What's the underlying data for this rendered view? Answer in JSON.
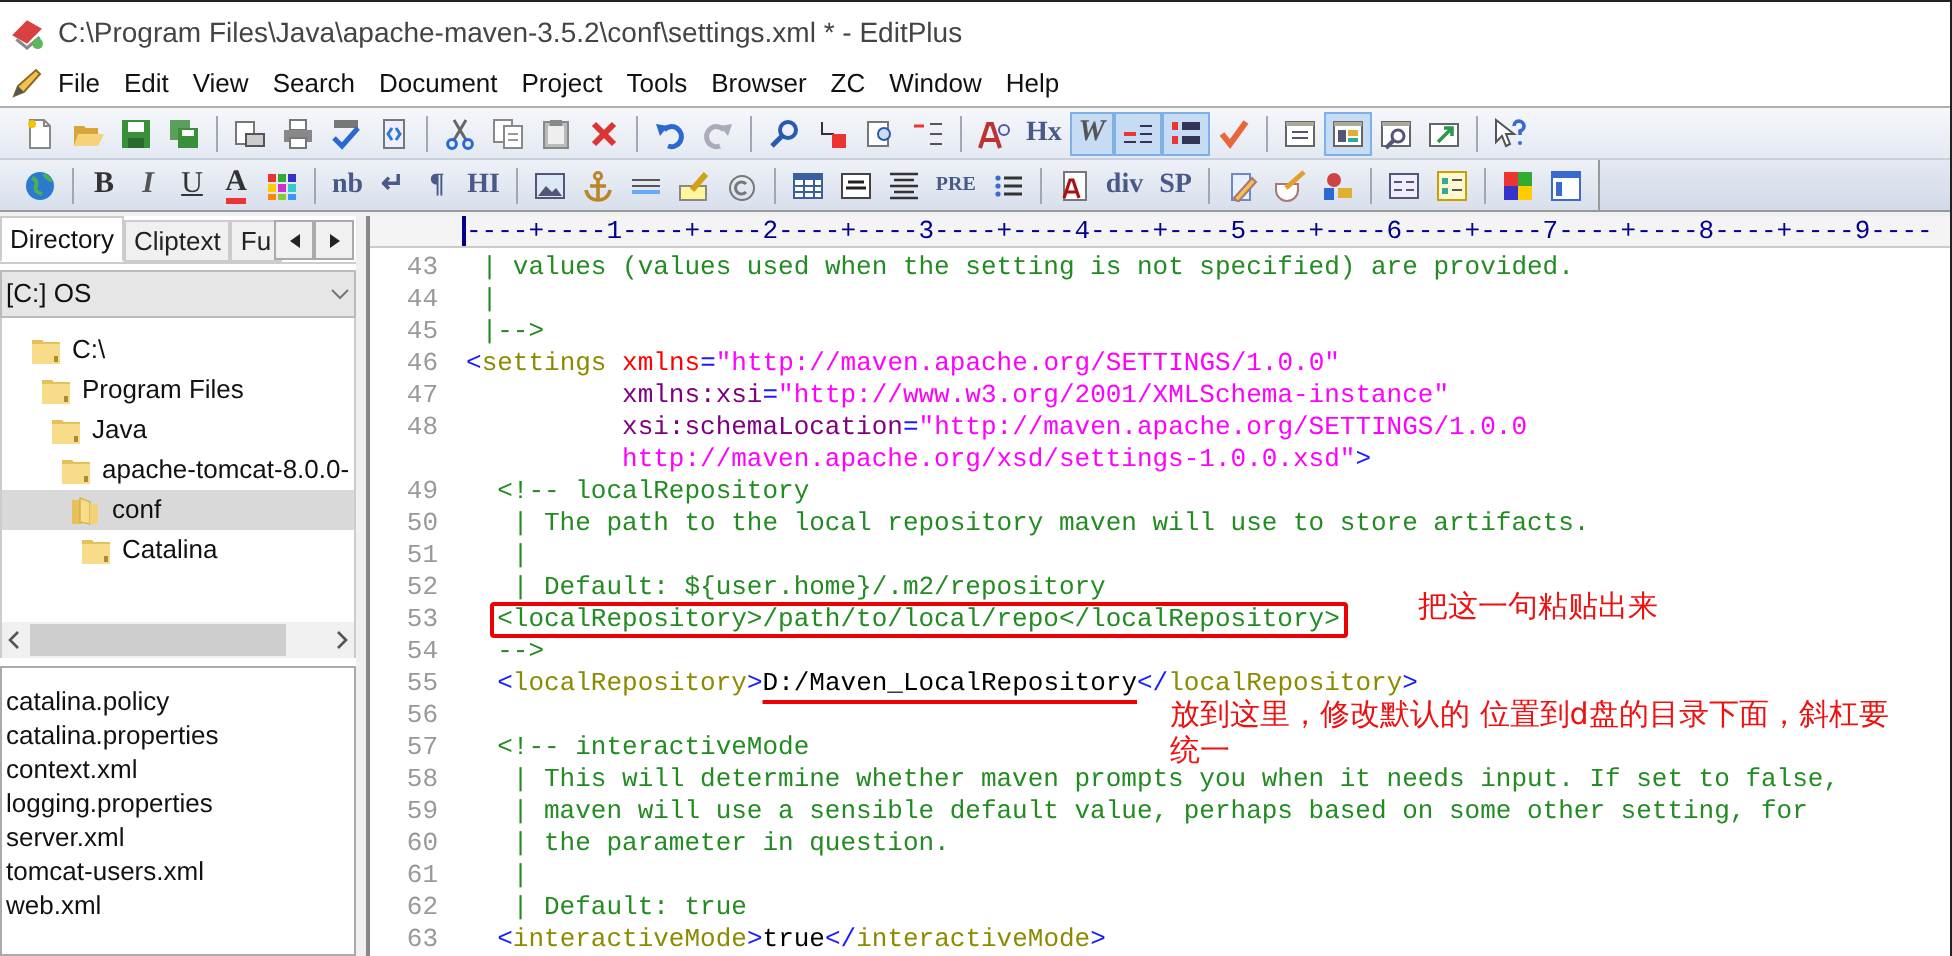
{
  "window": {
    "title": "C:\\Program Files\\Java\\apache-maven-3.5.2\\conf\\settings.xml * - EditPlus"
  },
  "menu": [
    "File",
    "Edit",
    "View",
    "Search",
    "Document",
    "Project",
    "Tools",
    "Browser",
    "ZC",
    "Window",
    "Help"
  ],
  "toolbar_1": [
    [
      {
        "kind": "icon",
        "on": false
      },
      {
        "kind": "icon",
        "on": false
      },
      {
        "kind": "icon",
        "on": false
      },
      {
        "kind": "icon",
        "on": false
      }
    ],
    [
      {
        "kind": "icon",
        "on": false
      },
      {
        "kind": "icon",
        "on": false
      },
      {
        "kind": "icon",
        "on": false
      },
      {
        "kind": "icon",
        "on": false
      }
    ],
    [
      {
        "kind": "icon",
        "on": false
      },
      {
        "kind": "icon",
        "on": false
      },
      {
        "kind": "icon",
        "on": false
      },
      {
        "kind": "icon",
        "on": false
      }
    ],
    [
      {
        "kind": "icon",
        "on": false
      },
      {
        "kind": "icon",
        "on": false
      }
    ],
    [
      {
        "kind": "icon",
        "on": false
      },
      {
        "kind": "icon",
        "on": false
      },
      {
        "kind": "icon",
        "on": false
      },
      {
        "kind": "icon",
        "on": false
      }
    ],
    [
      {
        "kind": "icon",
        "on": false
      },
      {
        "kind": "text",
        "label": "Hx",
        "on": false
      },
      {
        "kind": "italic",
        "label": "W",
        "on": true
      },
      {
        "kind": "icon",
        "on": true
      },
      {
        "kind": "icon",
        "on": true
      },
      {
        "kind": "icon",
        "on": false
      }
    ],
    [
      {
        "kind": "icon",
        "on": false
      },
      {
        "kind": "icon",
        "on": true
      },
      {
        "kind": "icon",
        "on": false
      },
      {
        "kind": "icon",
        "on": false
      }
    ],
    [
      {
        "kind": "icon",
        "on": false
      }
    ]
  ],
  "toolbar_2": [
    [
      {
        "kind": "icon"
      }
    ],
    [
      {
        "kind": "bold",
        "label": "B"
      },
      {
        "kind": "italic",
        "label": "I"
      },
      {
        "kind": "underline",
        "label": "U"
      },
      {
        "kind": "color",
        "label": "A"
      },
      {
        "kind": "icon"
      }
    ],
    [
      {
        "kind": "text",
        "label": "nb"
      },
      {
        "kind": "text",
        "label": "↵"
      },
      {
        "kind": "text",
        "label": "¶"
      },
      {
        "kind": "text",
        "label": "HI"
      }
    ],
    [
      {
        "kind": "icon"
      },
      {
        "kind": "icon"
      },
      {
        "kind": "icon"
      },
      {
        "kind": "icon"
      },
      {
        "kind": "icon"
      }
    ],
    [
      {
        "kind": "icon"
      },
      {
        "kind": "icon"
      },
      {
        "kind": "icon"
      },
      {
        "kind": "small",
        "label": "PRE"
      },
      {
        "kind": "icon"
      }
    ],
    [
      {
        "kind": "icon"
      },
      {
        "kind": "text",
        "label": "div"
      },
      {
        "kind": "text",
        "label": "SP"
      }
    ],
    [
      {
        "kind": "icon"
      },
      {
        "kind": "icon"
      },
      {
        "kind": "icon"
      }
    ],
    [
      {
        "kind": "icon"
      },
      {
        "kind": "icon"
      }
    ],
    [
      {
        "kind": "icon"
      },
      {
        "kind": "icon"
      }
    ]
  ],
  "side_tabs": [
    {
      "label": "Directory",
      "selected": true
    },
    {
      "label": "Cliptext",
      "selected": false
    },
    {
      "label": "Fu",
      "selected": false
    }
  ],
  "drive": {
    "value": "[C:] OS"
  },
  "tree": [
    {
      "label": "C:\\",
      "selected": false,
      "children": [
        {
          "label": "Program Files",
          "selected": false,
          "children": [
            {
              "label": "Java",
              "selected": false,
              "children": [
                {
                  "label": "apache-tomcat-8.0.0-",
                  "selected": false,
                  "children": [
                    {
                      "label": "conf",
                      "selected": true,
                      "children": [
                        {
                          "label": "Catalina",
                          "selected": false
                        }
                      ]
                    }
                  ]
                }
              ]
            }
          ]
        }
      ]
    }
  ],
  "files": [
    {
      "name": "catalina.policy",
      "selected": false
    },
    {
      "name": "catalina.properties",
      "selected": false
    },
    {
      "name": "context.xml",
      "selected": false
    },
    {
      "name": "logging.properties",
      "selected": false
    },
    {
      "name": "server.xml",
      "selected": false
    },
    {
      "name": "tomcat-users.xml",
      "selected": false
    },
    {
      "name": "web.xml",
      "selected": false
    }
  ],
  "ruler": "----+----1----+----2----+----3----+----4----+----5----+----6----+----7----+----8----+----9----",
  "lines": [
    {
      "number": "43",
      "segments": [
        {
          "kind": "comment",
          "text": " | values (values used when the setting is not specified) are provided."
        }
      ]
    },
    {
      "number": "44",
      "segments": [
        {
          "kind": "comment",
          "text": " |"
        }
      ]
    },
    {
      "number": "45",
      "segments": [
        {
          "kind": "comment",
          "text": " |-->"
        }
      ]
    },
    {
      "number": "46",
      "segments": [
        {
          "kind": "bracket",
          "text": "<"
        },
        {
          "kind": "tag",
          "text": "settings"
        },
        {
          "kind": "keyword",
          "text": " xmlns"
        },
        {
          "kind": "bracket",
          "text": "="
        },
        {
          "kind": "value",
          "text": "\"http://maven.apache.org/SETTINGS/1.0.0\""
        }
      ]
    },
    {
      "number": "47",
      "segments": [
        {
          "kind": "attr",
          "text": "          xmlns:xsi"
        },
        {
          "kind": "bracket",
          "text": "="
        },
        {
          "kind": "value",
          "text": "\"http://www.w3.org/2001/XMLSchema-instance\""
        }
      ]
    },
    {
      "number": "48",
      "segments": [
        {
          "kind": "attr",
          "text": "          xsi:schemaLocation"
        },
        {
          "kind": "bracket",
          "text": "="
        },
        {
          "kind": "value",
          "text": "\"http://maven.apache.org/SETTINGS/1.0.0"
        }
      ]
    },
    {
      "segments": [
        {
          "kind": "value",
          "text": "          http://maven.apache.org/xsd/settings-1.0.0.xsd\""
        },
        {
          "kind": "bracket",
          "text": ">"
        }
      ]
    },
    {
      "number": "49",
      "segments": [
        {
          "kind": "comment",
          "text": "  <!-- localRepository"
        }
      ]
    },
    {
      "number": "50",
      "segments": [
        {
          "kind": "comment",
          "text": "   | The path to the local repository maven will use to store artifacts."
        }
      ]
    },
    {
      "number": "51",
      "segments": [
        {
          "kind": "comment",
          "text": "   |"
        }
      ]
    },
    {
      "number": "52",
      "segments": [
        {
          "kind": "comment",
          "text": "   | Default: ${user.home}/.m2/repository"
        }
      ]
    },
    {
      "number": "53",
      "segments": [
        {
          "kind": "boxed-comment",
          "text": "  <localRepository>/path/to/local/repo</localRepository>"
        }
      ]
    },
    {
      "number": "54",
      "segments": [
        {
          "kind": "comment",
          "text": "  -->"
        }
      ]
    },
    {
      "number": "55",
      "segments": [
        {
          "kind": "bracket",
          "text": "  <"
        },
        {
          "kind": "tag",
          "text": "localRepository"
        },
        {
          "kind": "bracket",
          "text": ">"
        },
        {
          "kind": "underlined-text",
          "text": "D:/Maven_LocalRepository"
        },
        {
          "kind": "bracket",
          "text": "</"
        },
        {
          "kind": "tag",
          "text": "localRepository"
        },
        {
          "kind": "bracket",
          "text": ">"
        }
      ]
    },
    {
      "number": "56"
    },
    {
      "number": "57",
      "segments": [
        {
          "kind": "comment",
          "text": "  <!-- interactiveMode"
        }
      ]
    },
    {
      "number": "58",
      "segments": [
        {
          "kind": "comment",
          "text": "   | This will determine whether maven prompts you when it needs input. If set to false,"
        }
      ]
    },
    {
      "number": "59",
      "segments": [
        {
          "kind": "comment",
          "text": "   | maven will use a sensible default value, perhaps based on some other setting, for"
        }
      ]
    },
    {
      "number": "60",
      "segments": [
        {
          "kind": "comment",
          "text": "   | the parameter in question."
        }
      ]
    },
    {
      "number": "61",
      "segments": [
        {
          "kind": "comment",
          "text": "   |"
        }
      ]
    },
    {
      "number": "62",
      "segments": [
        {
          "kind": "comment",
          "text": "   | Default: true"
        }
      ]
    },
    {
      "number": "63",
      "segments": [
        {
          "kind": "bracket",
          "text": "  <"
        },
        {
          "kind": "tag",
          "text": "interactiveMode"
        },
        {
          "kind": "bracket",
          "text": ">"
        },
        {
          "kind": "text",
          "text": "true"
        },
        {
          "kind": "bracket",
          "text": "</"
        },
        {
          "kind": "tag",
          "text": "interactiveMode"
        },
        {
          "kind": "bracket",
          "text": ">"
        }
      ]
    }
  ],
  "annotations": [
    {
      "kind": "copy-note",
      "text": "把这一句粘贴出来"
    },
    {
      "kind": "paste-note",
      "text": "放到这里，修改默认的 位置到d盘的目录下面，斜杠要统一"
    }
  ]
}
